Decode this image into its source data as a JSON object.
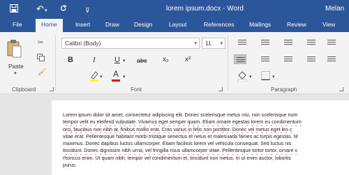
{
  "titlebar": {
    "doc_title": "lorem ipsum.docx - Word",
    "user": "Melan"
  },
  "tabs": [
    "File",
    "Home",
    "Insert",
    "Draw",
    "Design",
    "Layout",
    "References",
    "Mailings",
    "Review",
    "View"
  ],
  "ribbon": {
    "clipboard": {
      "paste_label": "Paste",
      "group_label": "Clipboard"
    },
    "font": {
      "font_name": "Calibri (Body)",
      "font_size": "11",
      "group_label": "Font",
      "buttons": {
        "bold": "B",
        "italic": "I",
        "underline": "U",
        "strikethrough": "abc",
        "subscript": "x₂",
        "superscript": "x²",
        "font_color": "A"
      },
      "colors": {
        "highlight": "#ffff00",
        "font_color": "#e00000"
      }
    },
    "paragraph": {
      "group_label": "Paragraph"
    }
  },
  "document": {
    "lines": [
      "Lorem ipsum dolor sit amet, consectetur adipiscing elit. Donec scelerisque metus nisi, non scelerisque num",
      "tempor velit eu eleifend vulputate. Vivamus eget semper quam. Etiam ornare egestas lorem eu condimentum",
      "orci, faucibus non nibh at, finibus mollis erat. Cras varius in felis non porttitor. Donec vel metus eget leo c",
      "vitae erat. Pellentesque habitant morbi tristique senectus et netus et malesuada fames ac turpis egestas. M",
      "maximus. Donec dapibus luctus ullamcorper. Etiam facilisis lorem vel vehicula consequat. Sed luctus nis",
      "tincidunt. Donec dignissim nibh urna, vel fringilla risus ullamcorper vitae. Pellentesque tortor tortor, ornare v",
      "rhoncus enim. Ut quam nibh, tempor vel condimentum et, tincidunt non metus. In ut enim auctor, lobortis",
      "purus."
    ]
  }
}
